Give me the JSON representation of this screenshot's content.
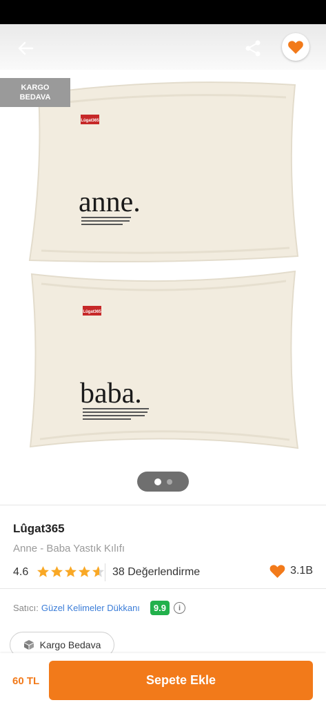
{
  "header": {
    "back_icon": "arrow-left-icon",
    "share_icon": "share-icon",
    "favorite_icon": "heart-icon",
    "accent_color": "#f27a1a"
  },
  "gallery": {
    "badge_line1": "KARGO",
    "badge_line2": "BEDAVA",
    "pillow_top_word": "anne.",
    "pillow_bottom_word": "baba.",
    "label_text": "Lûgat365",
    "page_count": 2,
    "active_page": 1
  },
  "product": {
    "brand": "Lûgat365",
    "name": "Anne - Baba Yastık Kılıfı",
    "rating": "4.6",
    "rating_value": 4.6,
    "reviews": "38 Değerlendirme",
    "likes": "3.1B"
  },
  "seller": {
    "label": "Satıcı:",
    "name": "Güzel Kelimeler Dükkanı",
    "score": "9.9",
    "score_color": "#22b14c"
  },
  "shipping": {
    "label": "Kargo Bedava",
    "icon": "box-icon"
  },
  "bottom": {
    "price": "60 TL",
    "add_to_cart": "Sepete Ekle"
  }
}
